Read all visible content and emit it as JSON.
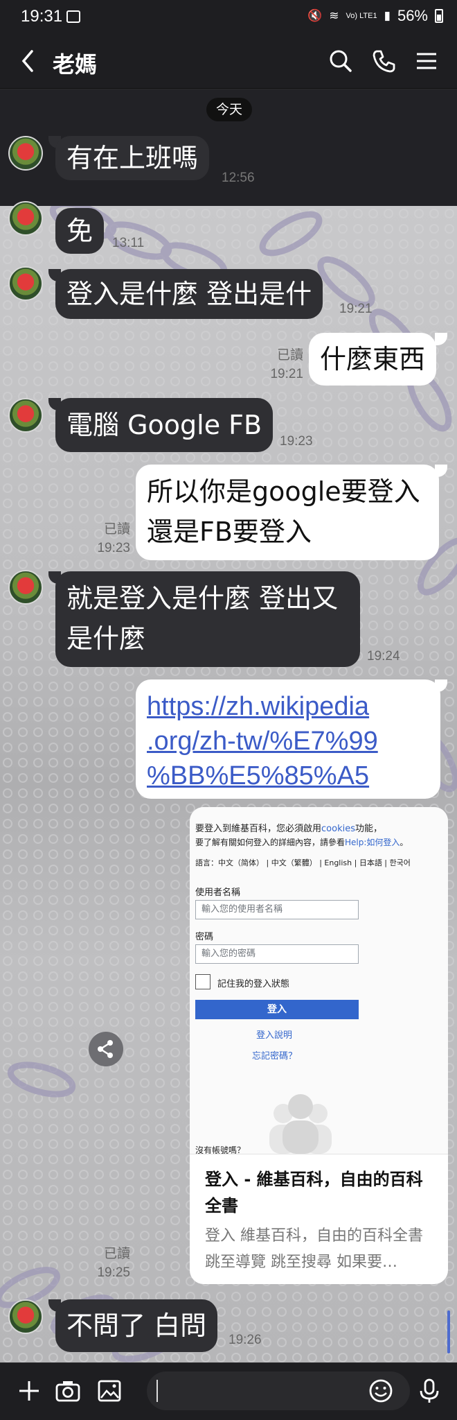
{
  "status_bar": {
    "time": "19:31",
    "network": "Vo) LTE1",
    "battery": "56%"
  },
  "header": {
    "title": "老媽"
  },
  "date_divider": "今天",
  "messages": {
    "m1": {
      "text": "有在上班嗎",
      "time": "12:56"
    },
    "m2": {
      "text": "免",
      "time": "13:11"
    },
    "m3": {
      "text": "登入是什麼 登出是什",
      "time": "19:21"
    },
    "m4": {
      "text": "什麼東西",
      "read": "已讀",
      "time": "19:21"
    },
    "m5": {
      "text": "電腦 Google FB",
      "time": "19:23"
    },
    "m6": {
      "line1": "所以你是google要登入",
      "line2": "還是FB要登入",
      "read": "已讀",
      "time": "19:23"
    },
    "m7": {
      "line1": "就是登入是什麼 登出又",
      "line2": "是什麼",
      "time": "19:24"
    },
    "m8": {
      "line1": "https://zh.wikipedia",
      "line2": ".org/zh-tw/%E7%99",
      "line3": "%BB%E5%85%A5"
    },
    "m9": {
      "read": "已讀",
      "time": "19:25"
    },
    "m10": {
      "text": "不問了 白問",
      "time": "19:26"
    }
  },
  "preview": {
    "screenshot": {
      "line1_a": "要登入到維基百科，您必須啟用",
      "line1_link": "cookies",
      "line1_b": "功能，",
      "line2_a": "要了解有關如何登入的詳細內容，請參看",
      "line2_link": "Help:如何登入",
      "line2_b": "。",
      "lang": "語言：中文（简体） | 中文（繁體） | English | 日本語 | 한국어",
      "username_label": "使用者名稱",
      "username_placeholder": "輸入您的使用者名稱",
      "password_label": "密碼",
      "password_placeholder": "輸入您的密碼",
      "remember": "記住我的登入狀態",
      "login_button": "登入",
      "help_link": "登入說明",
      "forgot_link": "忘記密碼？",
      "no_account": "沒有帳號嗎？"
    },
    "title": "登入 - 維基百科，自由的百科全書",
    "description": "登入 維基百科，自由的百科全書 跳至導覽 跳至搜尋 如果要…"
  },
  "icons": {
    "back": "back-arrow-icon",
    "search": "search-icon",
    "call": "phone-icon",
    "menu": "hamburger-menu-icon",
    "share": "share-icon",
    "plus": "plus-icon",
    "camera": "camera-icon",
    "image": "image-icon",
    "emoji": "emoji-icon",
    "mic": "microphone-icon"
  },
  "colors": {
    "incoming_bubble": "#2f2f33",
    "outgoing_bubble": "#ffffff",
    "link": "#3b5bc7",
    "header": "#1e1e21"
  }
}
